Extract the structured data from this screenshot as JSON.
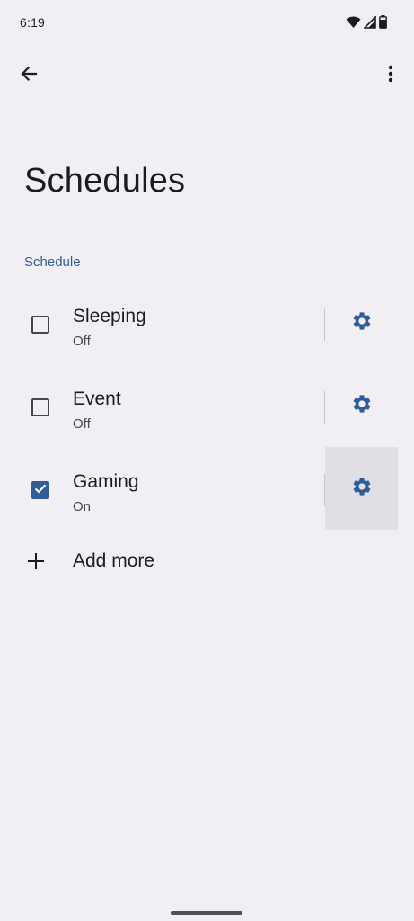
{
  "status_bar": {
    "time": "6:19",
    "icons": [
      "wifi-icon",
      "cellular-signal-icon",
      "battery-icon"
    ]
  },
  "app_bar": {
    "back_icon": "arrow-back-icon",
    "more_icon": "more-vert-icon"
  },
  "page": {
    "title": "Schedules",
    "section_header": "Schedule"
  },
  "schedules": [
    {
      "name": "Sleeping",
      "status": "Off",
      "checked": false
    },
    {
      "name": "Event",
      "status": "Off",
      "checked": false
    },
    {
      "name": "Gaming",
      "status": "On",
      "checked": true
    }
  ],
  "add_more": {
    "label": "Add more",
    "icon": "plus-icon"
  },
  "colors": {
    "background": "#f2eff4",
    "accent": "#2f5d9a",
    "text_primary": "#1c1b1f",
    "text_secondary": "#49454f"
  }
}
